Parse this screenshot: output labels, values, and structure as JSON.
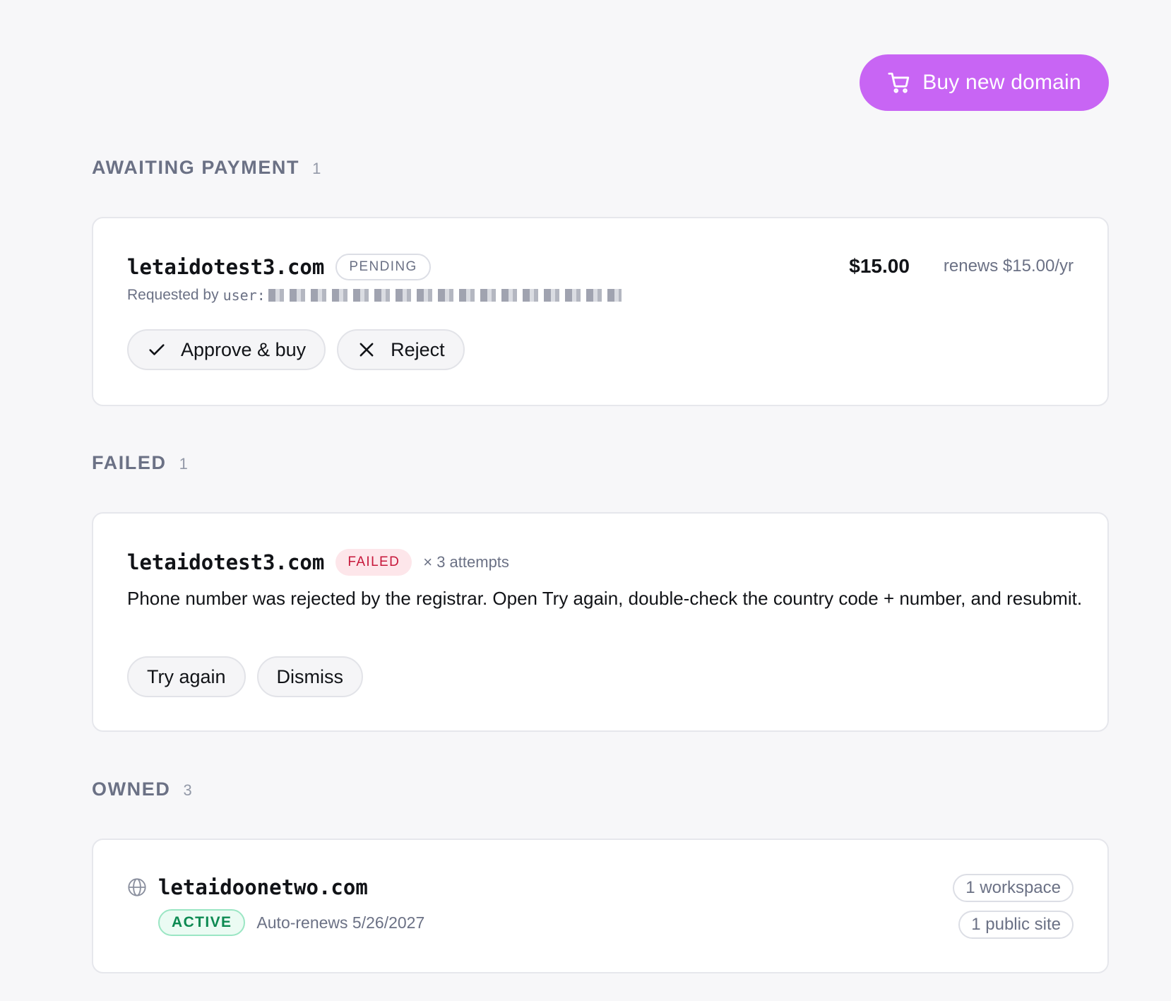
{
  "toolbar": {
    "buy_label": "Buy new domain",
    "buy_icon": "cart-icon",
    "accent": "#c865f4"
  },
  "sections": {
    "awaiting": {
      "title": "AWAITING PAYMENT",
      "count": "1",
      "item": {
        "domain": "letaidotest3.com",
        "badge": "PENDING",
        "requested_label": "Requested by",
        "requested_user_prefix": "user:",
        "price": "$15.00",
        "renews": "renews $15.00/yr",
        "approve_label": "Approve & buy",
        "reject_label": "Reject"
      }
    },
    "failed": {
      "title": "FAILED",
      "count": "1",
      "item": {
        "domain": "letaidotest3.com",
        "badge": "FAILED",
        "attempts": "× 3 attempts",
        "message": "Phone number was rejected by the registrar. Open Try again, double-check the country code + number, and resubmit.",
        "retry_label": "Try again",
        "dismiss_label": "Dismiss"
      }
    },
    "owned": {
      "title": "OWNED",
      "count": "3",
      "item": {
        "domain": "letaidoonetwo.com",
        "badge": "ACTIVE",
        "renew_text": "Auto-renews 5/26/2027",
        "workspaces": "1 workspace",
        "sites": "1 public site"
      }
    }
  }
}
